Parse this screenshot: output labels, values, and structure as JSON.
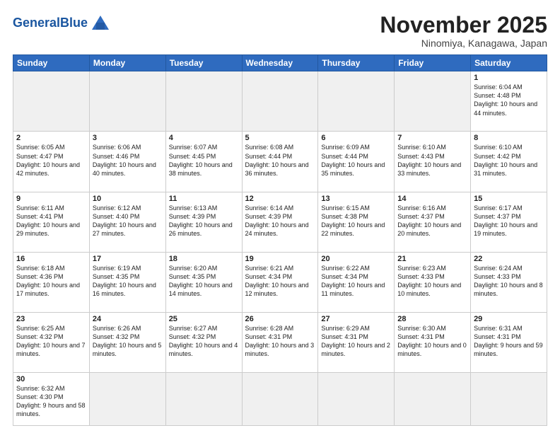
{
  "header": {
    "logo_general": "General",
    "logo_blue": "Blue",
    "month": "November 2025",
    "location": "Ninomiya, Kanagawa, Japan"
  },
  "days_of_week": [
    "Sunday",
    "Monday",
    "Tuesday",
    "Wednesday",
    "Thursday",
    "Friday",
    "Saturday"
  ],
  "weeks": [
    [
      {
        "day": "",
        "info": ""
      },
      {
        "day": "",
        "info": ""
      },
      {
        "day": "",
        "info": ""
      },
      {
        "day": "",
        "info": ""
      },
      {
        "day": "",
        "info": ""
      },
      {
        "day": "",
        "info": ""
      },
      {
        "day": "1",
        "info": "Sunrise: 6:04 AM\nSunset: 4:48 PM\nDaylight: 10 hours and 44 minutes."
      }
    ],
    [
      {
        "day": "2",
        "info": "Sunrise: 6:05 AM\nSunset: 4:47 PM\nDaylight: 10 hours and 42 minutes."
      },
      {
        "day": "3",
        "info": "Sunrise: 6:06 AM\nSunset: 4:46 PM\nDaylight: 10 hours and 40 minutes."
      },
      {
        "day": "4",
        "info": "Sunrise: 6:07 AM\nSunset: 4:45 PM\nDaylight: 10 hours and 38 minutes."
      },
      {
        "day": "5",
        "info": "Sunrise: 6:08 AM\nSunset: 4:44 PM\nDaylight: 10 hours and 36 minutes."
      },
      {
        "day": "6",
        "info": "Sunrise: 6:09 AM\nSunset: 4:44 PM\nDaylight: 10 hours and 35 minutes."
      },
      {
        "day": "7",
        "info": "Sunrise: 6:10 AM\nSunset: 4:43 PM\nDaylight: 10 hours and 33 minutes."
      },
      {
        "day": "8",
        "info": "Sunrise: 6:10 AM\nSunset: 4:42 PM\nDaylight: 10 hours and 31 minutes."
      }
    ],
    [
      {
        "day": "9",
        "info": "Sunrise: 6:11 AM\nSunset: 4:41 PM\nDaylight: 10 hours and 29 minutes."
      },
      {
        "day": "10",
        "info": "Sunrise: 6:12 AM\nSunset: 4:40 PM\nDaylight: 10 hours and 27 minutes."
      },
      {
        "day": "11",
        "info": "Sunrise: 6:13 AM\nSunset: 4:39 PM\nDaylight: 10 hours and 26 minutes."
      },
      {
        "day": "12",
        "info": "Sunrise: 6:14 AM\nSunset: 4:39 PM\nDaylight: 10 hours and 24 minutes."
      },
      {
        "day": "13",
        "info": "Sunrise: 6:15 AM\nSunset: 4:38 PM\nDaylight: 10 hours and 22 minutes."
      },
      {
        "day": "14",
        "info": "Sunrise: 6:16 AM\nSunset: 4:37 PM\nDaylight: 10 hours and 20 minutes."
      },
      {
        "day": "15",
        "info": "Sunrise: 6:17 AM\nSunset: 4:37 PM\nDaylight: 10 hours and 19 minutes."
      }
    ],
    [
      {
        "day": "16",
        "info": "Sunrise: 6:18 AM\nSunset: 4:36 PM\nDaylight: 10 hours and 17 minutes."
      },
      {
        "day": "17",
        "info": "Sunrise: 6:19 AM\nSunset: 4:35 PM\nDaylight: 10 hours and 16 minutes."
      },
      {
        "day": "18",
        "info": "Sunrise: 6:20 AM\nSunset: 4:35 PM\nDaylight: 10 hours and 14 minutes."
      },
      {
        "day": "19",
        "info": "Sunrise: 6:21 AM\nSunset: 4:34 PM\nDaylight: 10 hours and 12 minutes."
      },
      {
        "day": "20",
        "info": "Sunrise: 6:22 AM\nSunset: 4:34 PM\nDaylight: 10 hours and 11 minutes."
      },
      {
        "day": "21",
        "info": "Sunrise: 6:23 AM\nSunset: 4:33 PM\nDaylight: 10 hours and 10 minutes."
      },
      {
        "day": "22",
        "info": "Sunrise: 6:24 AM\nSunset: 4:33 PM\nDaylight: 10 hours and 8 minutes."
      }
    ],
    [
      {
        "day": "23",
        "info": "Sunrise: 6:25 AM\nSunset: 4:32 PM\nDaylight: 10 hours and 7 minutes."
      },
      {
        "day": "24",
        "info": "Sunrise: 6:26 AM\nSunset: 4:32 PM\nDaylight: 10 hours and 5 minutes."
      },
      {
        "day": "25",
        "info": "Sunrise: 6:27 AM\nSunset: 4:32 PM\nDaylight: 10 hours and 4 minutes."
      },
      {
        "day": "26",
        "info": "Sunrise: 6:28 AM\nSunset: 4:31 PM\nDaylight: 10 hours and 3 minutes."
      },
      {
        "day": "27",
        "info": "Sunrise: 6:29 AM\nSunset: 4:31 PM\nDaylight: 10 hours and 2 minutes."
      },
      {
        "day": "28",
        "info": "Sunrise: 6:30 AM\nSunset: 4:31 PM\nDaylight: 10 hours and 0 minutes."
      },
      {
        "day": "29",
        "info": "Sunrise: 6:31 AM\nSunset: 4:31 PM\nDaylight: 9 hours and 59 minutes."
      }
    ],
    [
      {
        "day": "30",
        "info": "Sunrise: 6:32 AM\nSunset: 4:30 PM\nDaylight: 9 hours and 58 minutes."
      },
      {
        "day": "",
        "info": ""
      },
      {
        "day": "",
        "info": ""
      },
      {
        "day": "",
        "info": ""
      },
      {
        "day": "",
        "info": ""
      },
      {
        "day": "",
        "info": ""
      },
      {
        "day": "",
        "info": ""
      }
    ]
  ]
}
